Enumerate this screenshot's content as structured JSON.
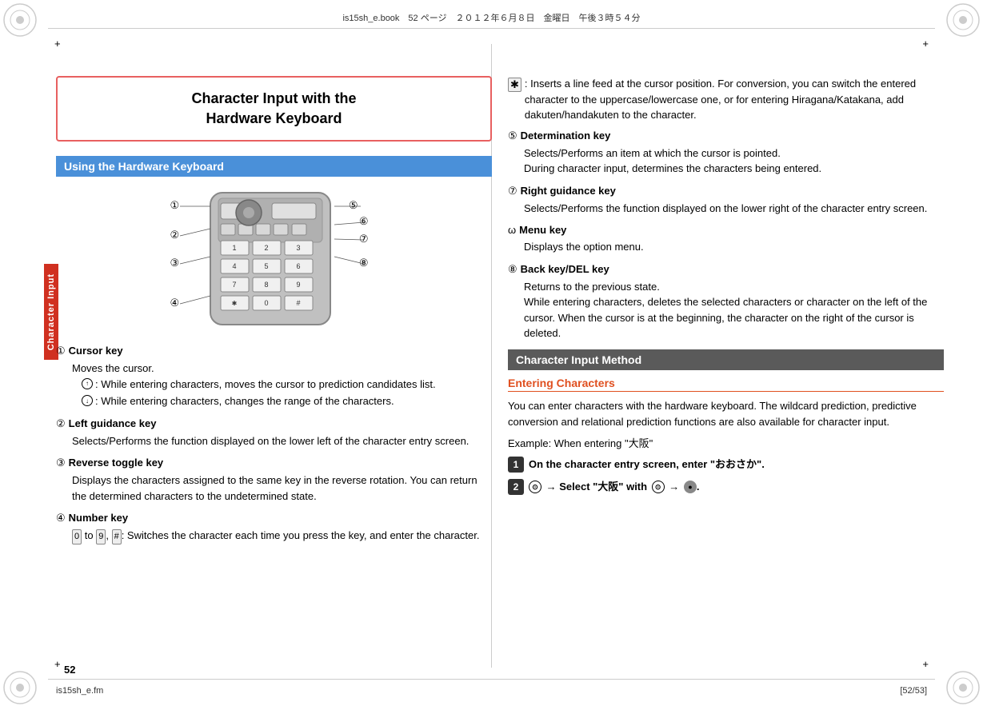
{
  "meta": {
    "top_bar": "is15sh_e.book　52 ページ　２０１２年６月８日　金曜日　午後３時５４分",
    "bottom_left": "is15sh_e.fm",
    "bottom_right": "[52/53]",
    "page_number": "52"
  },
  "title": {
    "line1": "Character Input with the",
    "line2": "Hardware Keyboard"
  },
  "left": {
    "section1_header": "Using the Hardware Keyboard",
    "items": [
      {
        "num": "①",
        "label": "Cursor key",
        "desc": "Moves the cursor.",
        "bullets": [
          ": While entering characters, moves the cursor to prediction candidates list.",
          ": While entering characters, changes the range of the characters."
        ]
      },
      {
        "num": "②",
        "label": "Left guidance key",
        "desc": "Selects/Performs the function displayed on the lower left of the character entry screen."
      },
      {
        "num": "③",
        "label": "Reverse toggle key",
        "desc": "Displays the characters assigned to the same key in the reverse rotation. You can return the determined characters to the undetermined state."
      },
      {
        "num": "④",
        "label": "Number key",
        "desc": " to  , : Switches the character each time you press the key, and enter the character.",
        "keys": [
          "0",
          "9",
          "#"
        ]
      }
    ]
  },
  "right": {
    "items_top": [
      {
        "symbol": "✱",
        "desc": ": Inserts a line feed at the cursor position. For conversion, you can switch the entered character to the uppercase/lowercase one, or for entering Hiragana/Katakana, add dakuten/handakuten to the character."
      }
    ],
    "items": [
      {
        "num": "⑤",
        "label": "Determination key",
        "desc1": "Selects/Performs an item at which the cursor is pointed.",
        "desc2": "During character input, determines the characters being entered."
      },
      {
        "num": "⑦",
        "label": "Right guidance key",
        "desc1": "Selects/Performs the function displayed on the lower right of the character entry screen."
      },
      {
        "num": "ω",
        "label": "Menu key",
        "desc1": "Displays the option menu."
      },
      {
        "num": "⑧",
        "label": "Back key/DEL key",
        "desc1": "Returns to the previous state.",
        "desc2": "While entering characters, deletes the selected characters or character on the left of the cursor. When the cursor is at the beginning, the character on the right of the cursor is deleted."
      }
    ],
    "section2_header": "Character Input Method",
    "entering_header": "Entering Characters",
    "entering_desc": "You can enter characters with the hardware keyboard. The wildcard prediction, predictive conversion and relational prediction functions are also available for character input.",
    "example_label": "Example: When entering \"大阪\"",
    "steps": [
      {
        "num": "1",
        "text": "On the character entry screen, enter \"おおさか\"."
      },
      {
        "num": "2",
        "text": "⊙ → Select \"大阪\" with ⊙ → ●."
      }
    ]
  },
  "vertical_tab_label": "Character Input"
}
